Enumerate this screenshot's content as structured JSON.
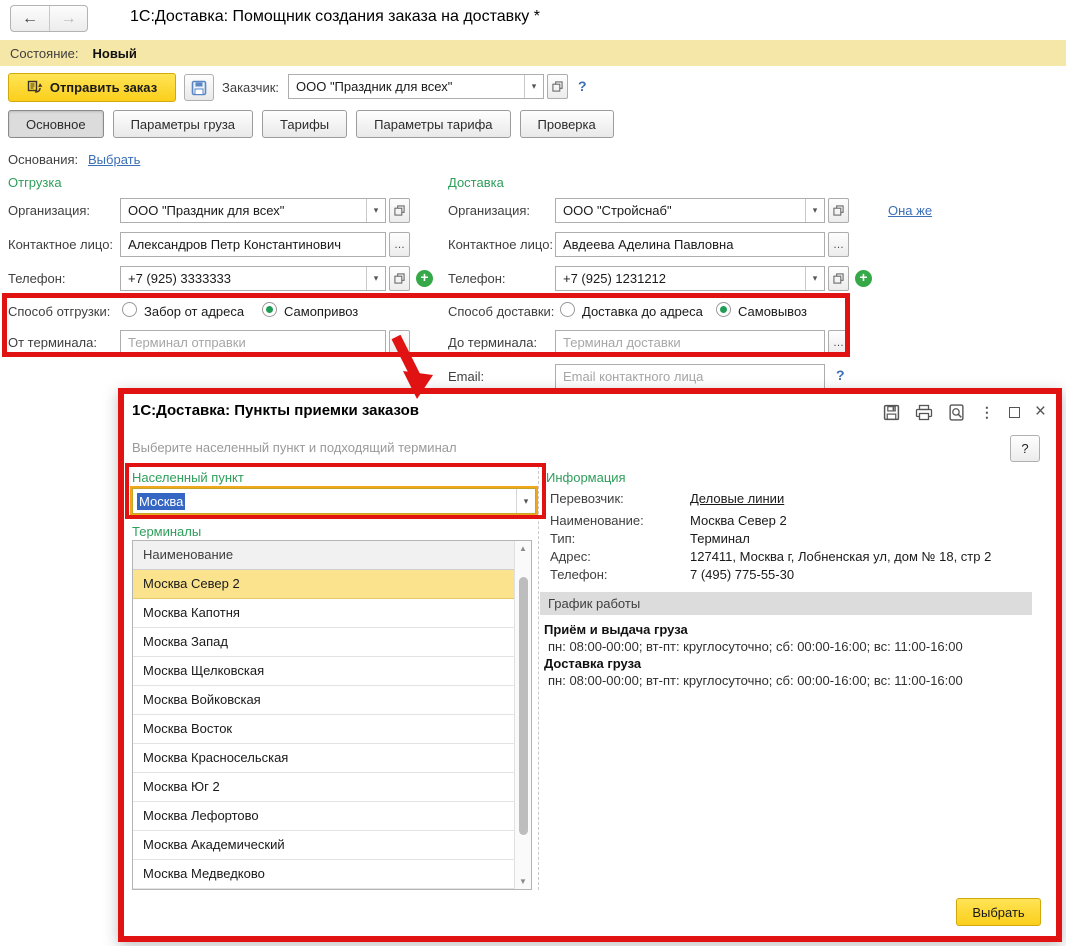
{
  "window": {
    "back": "←",
    "forward": "→",
    "title": "1С:Доставка: Помощник создания заказа на доставку *",
    "status_label": "Состояние:",
    "status_value": "Новый"
  },
  "toolbar": {
    "send_label": "Отправить заказ",
    "customer_label": "Заказчик:",
    "customer_value": "ООО \"Праздник для всех\"",
    "help": "?"
  },
  "tabs": [
    {
      "label": "Основное",
      "active": true
    },
    {
      "label": "Параметры груза",
      "active": false
    },
    {
      "label": "Тарифы",
      "active": false
    },
    {
      "label": "Параметры тарифа",
      "active": false
    },
    {
      "label": "Проверка",
      "active": false
    }
  ],
  "bases": {
    "label": "Основания:",
    "link": "Выбрать"
  },
  "shipment": {
    "header": "Отгрузка",
    "org_label": "Организация:",
    "org_value": "ООО \"Праздник для всех\"",
    "contact_label": "Контактное лицо:",
    "contact_value": "Александров Петр Константинович",
    "phone_label": "Телефон:",
    "phone_value": "+7 (925) 3333333",
    "method_label": "Способ отгрузки:",
    "method_option1": "Забор от адреса",
    "method_option2": "Самопривоз",
    "method_selected": "Самопривоз",
    "terminal_label": "От терминала:",
    "terminal_placeholder": "Терминал отправки"
  },
  "delivery": {
    "header": "Доставка",
    "org_label": "Организация:",
    "org_value": "ООО \"Стройснаб\"",
    "same_link": "Она же",
    "contact_label": "Контактное лицо:",
    "contact_value": "Авдеева Аделина Павловна",
    "phone_label": "Телефон:",
    "phone_value": "+7 (925) 1231212",
    "method_label": "Способ доставки:",
    "method_option1": "Доставка до адреса",
    "method_option2": "Самовывоз",
    "method_selected": "Самовывоз",
    "terminal_label": "До терминала:",
    "terminal_placeholder": "Терминал доставки",
    "email_label": "Email:",
    "email_placeholder": "Email контактного лица",
    "email_help": "?"
  },
  "dialog": {
    "title": "1С:Доставка: Пункты приемки заказов",
    "subtitle": "Выберите населенный пункт и подходящий терминал",
    "help": "?",
    "city": {
      "label": "Населенный пункт",
      "value": "Москва"
    },
    "terminals": {
      "label": "Терминалы",
      "column": "Наименование",
      "selected": "Москва Север 2",
      "rows": [
        "Москва Север 2",
        "Москва Капотня",
        "Москва Запад",
        "Москва Щелковская",
        "Москва Войковская",
        "Москва Восток",
        "Москва Красносельская",
        "Москва Юг 2",
        "Москва Лефортово",
        "Москва Академический",
        "Москва Медведково"
      ]
    },
    "info": {
      "header": "Информация",
      "carrier_label": "Перевозчик:",
      "carrier_value": "Деловые линии",
      "name_label": "Наименование:",
      "name_value": "Москва Север 2",
      "type_label": "Тип:",
      "type_value": "Терминал",
      "address_label": "Адрес:",
      "address_value": "127411, Москва г, Лобненская ул, дом № 18, стр 2",
      "phone_label": "Телефон:",
      "phone_value": "7 (495) 775-55-30"
    },
    "schedule": {
      "header": "График работы",
      "section1_title": "Приём и выдача груза",
      "section1_hours": "пн: 08:00-00:00; вт-пт: круглосуточно; сб: 00:00-16:00; вс: 11:00-16:00",
      "section2_title": "Доставка груза",
      "section2_hours": "пн: 08:00-00:00; вт-пт: круглосуточно; сб: 00:00-16:00; вс: 11:00-16:00"
    },
    "select_button": "Выбрать"
  },
  "colors": {
    "highlight_red": "#e01212",
    "header_green": "#2e9e5b",
    "link_blue": "#3b6fb6",
    "button_yellow": "#fbcf1b",
    "row_selected": "#fbe38d",
    "status_bar_bg": "#f5e7a8",
    "input_selection": "#3566c4"
  }
}
